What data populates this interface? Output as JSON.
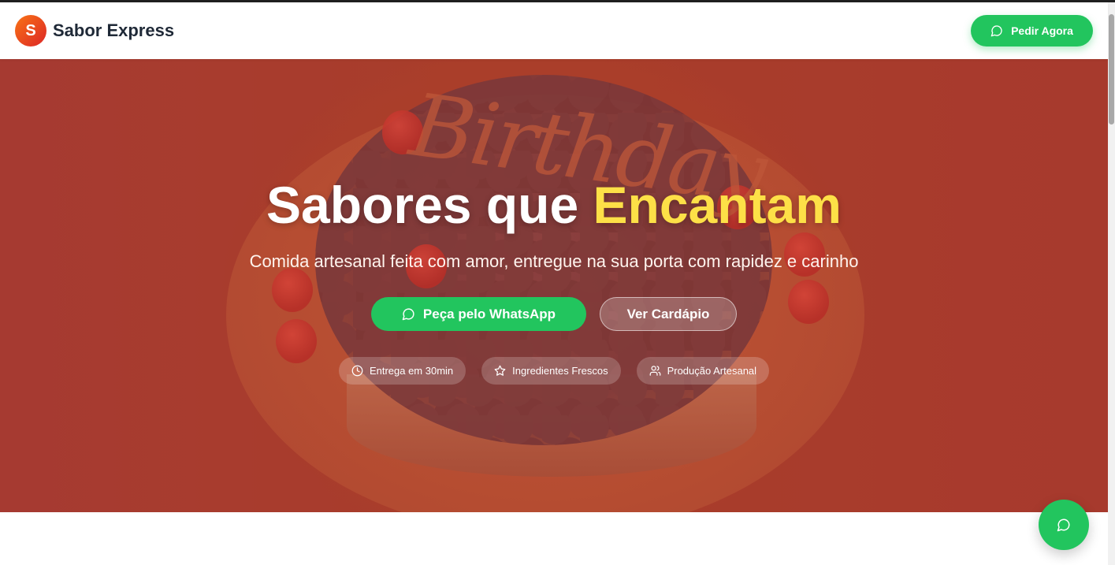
{
  "header": {
    "logo_letter": "S",
    "brand_name": "Sabor Express",
    "order_button_label": "Pedir Agora",
    "order_button_icon": "whatsapp-chat-icon"
  },
  "hero": {
    "title_main": "Sabores que",
    "title_accent": "Encantam",
    "subtitle": "Comida artesanal feita com amor, entregue na sua porta com rapidez e carinho",
    "primary_cta": "Peça pelo WhatsApp",
    "secondary_cta": "Ver Cardápio",
    "badges": [
      {
        "icon": "clock-icon",
        "label": "Entrega em 30min"
      },
      {
        "icon": "star-icon",
        "label": "Ingredientes Frescos"
      },
      {
        "icon": "users-icon",
        "label": "Produção Artesanal"
      }
    ],
    "background_image_caption": "Birthday"
  },
  "floating_button": {
    "icon": "whatsapp-chat-icon"
  },
  "colors": {
    "brand_green": "#22c55e",
    "accent_yellow": "#fde047",
    "logo_gradient_start": "#f97316",
    "logo_gradient_end": "#dc2626",
    "hero_tint": "#b73723"
  }
}
